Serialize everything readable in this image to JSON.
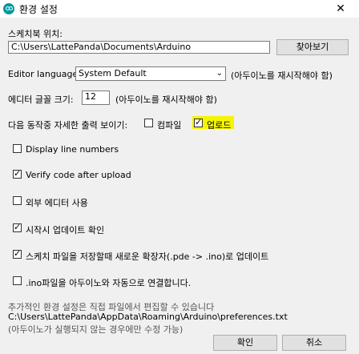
{
  "window": {
    "title": "환경 설정",
    "close": "✕"
  },
  "sketchbook": {
    "label": "스케치북 위치:",
    "value": "C:\\Users\\LattePanda\\Documents\\Arduino",
    "browse": "찾아보기"
  },
  "editor_language": {
    "label": "Editor language:",
    "value": "System Default",
    "note": "(아두이노를 재시작해야 함)"
  },
  "font_size": {
    "label": "에디터 글꼴 크기:",
    "value": "12",
    "note": "(아두이노를 재시작해야 함)"
  },
  "verbose": {
    "label": "다음 동작중 자세한 출력 보이기:",
    "compile_label": "컴파일",
    "compile_checked": false,
    "upload_label": "업로드",
    "upload_checked": true
  },
  "options": [
    {
      "label": "Display line numbers",
      "checked": false
    },
    {
      "label": "Verify code after upload",
      "checked": true
    },
    {
      "label": "외부 에디터 사용",
      "checked": false
    },
    {
      "label": "시작시 업데이트 확인",
      "checked": true
    },
    {
      "label": "스케치 파일을 저장할때 새로운 확장자(.pde -> .ino)로 업데이트",
      "checked": true
    },
    {
      "label": ".ino파일을 아두이노와 자동으로 연결합니다.",
      "checked": false
    }
  ],
  "footer": {
    "info1": "추가적인 환경 설정은 직접 파일에서 편집할 수 있습니다",
    "path": "C:\\Users\\LattePanda\\AppData\\Roaming\\Arduino\\preferences.txt",
    "info2": "(아두이노가 실행되지 않는 경우에만 수정 가능)",
    "ok": "확인",
    "cancel": "취소"
  },
  "colors": {
    "accent": "#00979c",
    "highlight": "#f5f500"
  }
}
